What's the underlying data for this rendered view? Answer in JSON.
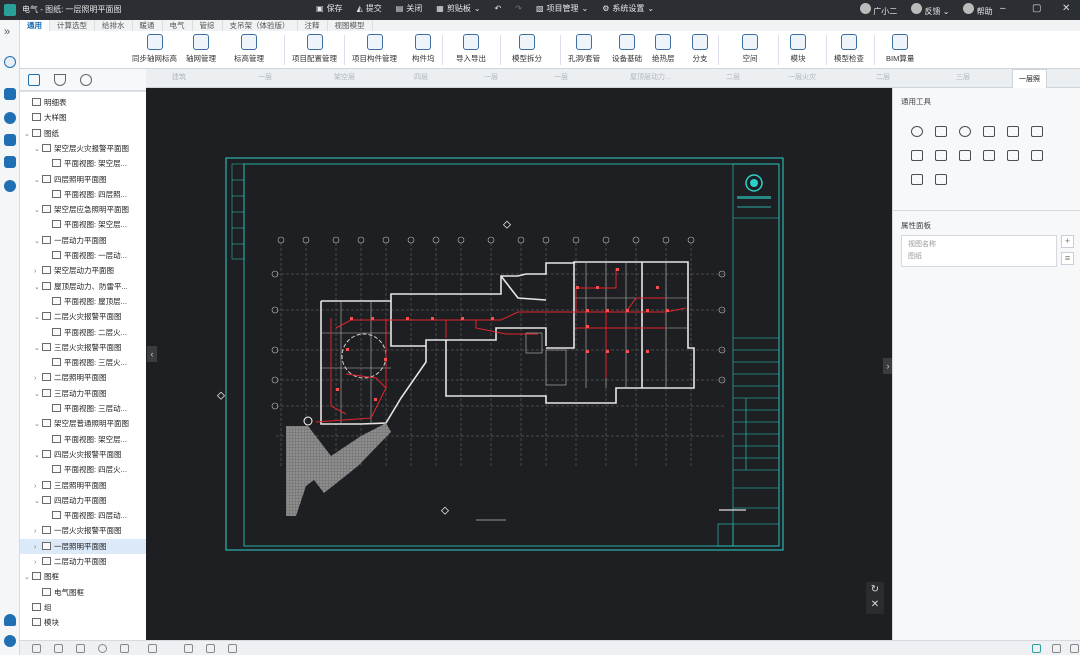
{
  "window": {
    "title": "电气 - 图纸: 一层照明平面图"
  },
  "titlebar_actions": {
    "save": "保存",
    "commit": "提交",
    "close": "关闭",
    "clipboard": "剪贴板",
    "project": "项目管理",
    "settings": "系统设置"
  },
  "user": {
    "name": "广小二",
    "feedback": "反馈",
    "help": "帮助"
  },
  "ribbon_tabs": [
    "通用",
    "计算选型",
    "给排水",
    "暖通",
    "电气",
    "管综",
    "支吊架（体验版）",
    "注释",
    "视图模型"
  ],
  "ribbon_buttons": [
    "同步轴网标高",
    "轴网管理",
    "标高管理",
    "项目配置管理",
    "项目构件管理",
    "构件坞",
    "导入导出",
    "模型拆分",
    "孔洞/套管",
    "设备基础",
    "绝热层",
    "分支",
    "空间",
    "模块",
    "模型检查",
    "BIM算量"
  ],
  "tree": [
    {
      "label": "明细表",
      "level": 0,
      "toggle": ""
    },
    {
      "label": "大样图",
      "level": 0,
      "toggle": ""
    },
    {
      "label": "图纸",
      "level": 0,
      "toggle": "v"
    },
    {
      "label": "架空层火灾报警平面图",
      "level": 1,
      "toggle": "v"
    },
    {
      "label": "平面视图: 架空层...",
      "level": 2,
      "toggle": ""
    },
    {
      "label": "四层照明平面图",
      "level": 1,
      "toggle": "v"
    },
    {
      "label": "平面视图: 四层照...",
      "level": 2,
      "toggle": ""
    },
    {
      "label": "架空层应急照明平面图",
      "level": 1,
      "toggle": "v"
    },
    {
      "label": "平面视图: 架空层...",
      "level": 2,
      "toggle": ""
    },
    {
      "label": "一层动力平面图",
      "level": 1,
      "toggle": "v"
    },
    {
      "label": "平面视图: 一层动...",
      "level": 2,
      "toggle": ""
    },
    {
      "label": "架空层动力平面图",
      "level": 1,
      "toggle": ">"
    },
    {
      "label": "屋顶层动力、防雷平...",
      "level": 1,
      "toggle": "v"
    },
    {
      "label": "平面视图: 屋顶层...",
      "level": 2,
      "toggle": ""
    },
    {
      "label": "二层火灾报警平面图",
      "level": 1,
      "toggle": "v"
    },
    {
      "label": "平面视图: 二层火...",
      "level": 2,
      "toggle": ""
    },
    {
      "label": "三层火灾报警平面图",
      "level": 1,
      "toggle": "v"
    },
    {
      "label": "平面视图: 三层火...",
      "level": 2,
      "toggle": ""
    },
    {
      "label": "二层照明平面图",
      "level": 1,
      "toggle": ">"
    },
    {
      "label": "三层动力平面图",
      "level": 1,
      "toggle": "v"
    },
    {
      "label": "平面视图: 三层动...",
      "level": 2,
      "toggle": ""
    },
    {
      "label": "架空层普通照明平面图",
      "level": 1,
      "toggle": "v"
    },
    {
      "label": "平面视图: 架空层...",
      "level": 2,
      "toggle": ""
    },
    {
      "label": "四层火灾报警平面图",
      "level": 1,
      "toggle": "v"
    },
    {
      "label": "平面视图: 四层火...",
      "level": 2,
      "toggle": ""
    },
    {
      "label": "三层照明平面图",
      "level": 1,
      "toggle": ">"
    },
    {
      "label": "四层动力平面图",
      "level": 1,
      "toggle": "v"
    },
    {
      "label": "平面视图: 四层动...",
      "level": 2,
      "toggle": ""
    },
    {
      "label": "一层火灾报警平面图",
      "level": 1,
      "toggle": ">"
    },
    {
      "label": "一层照明平面图",
      "level": 1,
      "toggle": ">",
      "selected": true
    },
    {
      "label": "二层动力平面图",
      "level": 1,
      "toggle": ">"
    },
    {
      "label": "图框",
      "level": 0,
      "toggle": "v"
    },
    {
      "label": "电气图框",
      "level": 1,
      "toggle": ""
    },
    {
      "label": "组",
      "level": 0,
      "toggle": ""
    },
    {
      "label": "模块",
      "level": 0,
      "toggle": ""
    }
  ],
  "doc_tabs": [
    "建筑",
    "一层",
    "架空层",
    "四层",
    "一层",
    "一层",
    "屋顶层动力...",
    "二层",
    "一层火灾",
    "二层",
    "三层",
    "一层照"
  ],
  "right_panel": {
    "tools_title": "通用工具",
    "props_title": "属性面板",
    "prop_name_label": "视图名称",
    "prop_name_value": "图纸"
  },
  "colors": {
    "canvas": "#1e1f22",
    "frame": "#2ad1c9",
    "wiring": "#e0262f",
    "accent": "#1b6fb5"
  }
}
